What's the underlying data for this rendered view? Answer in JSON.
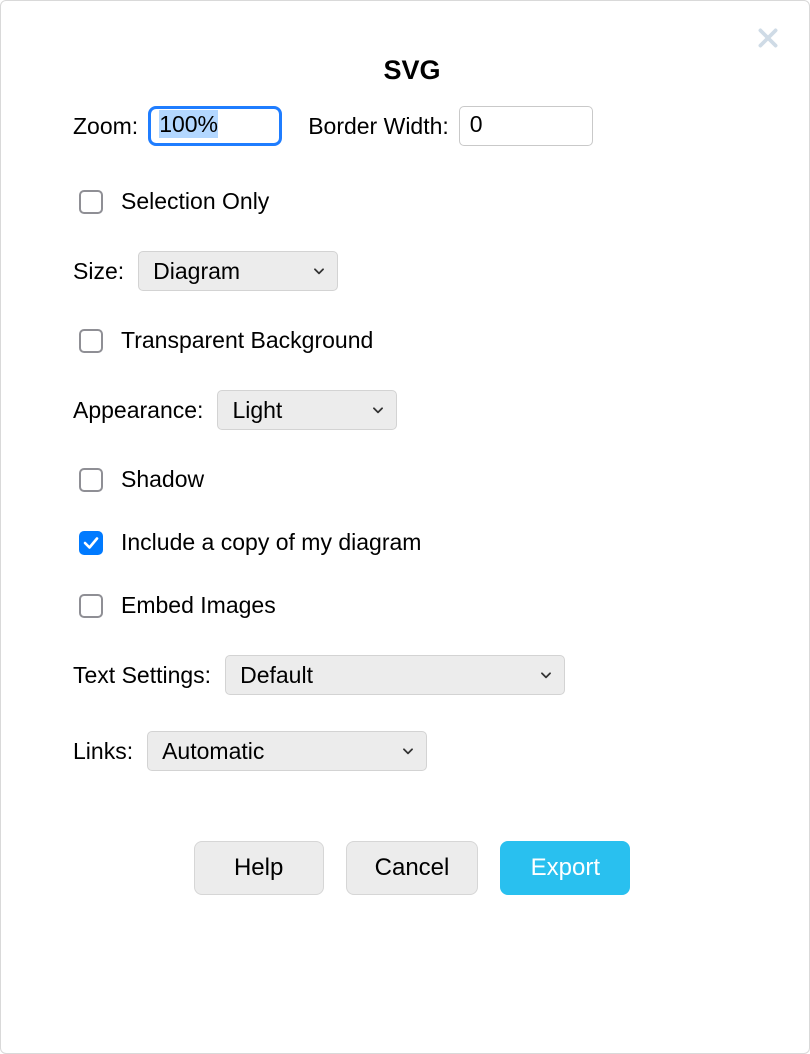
{
  "title": "SVG",
  "zoom": {
    "label": "Zoom:",
    "value": "100%"
  },
  "borderWidth": {
    "label": "Border Width:",
    "value": "0"
  },
  "selectionOnly": {
    "label": "Selection Only",
    "checked": false
  },
  "size": {
    "label": "Size:",
    "value": "Diagram"
  },
  "transparentBg": {
    "label": "Transparent Background",
    "checked": false
  },
  "appearance": {
    "label": "Appearance:",
    "value": "Light"
  },
  "shadow": {
    "label": "Shadow",
    "checked": false
  },
  "includeCopy": {
    "label": "Include a copy of my diagram",
    "checked": true
  },
  "embedImages": {
    "label": "Embed Images",
    "checked": false
  },
  "textSettings": {
    "label": "Text Settings:",
    "value": "Default"
  },
  "links": {
    "label": "Links:",
    "value": "Automatic"
  },
  "buttons": {
    "help": "Help",
    "cancel": "Cancel",
    "export": "Export"
  }
}
